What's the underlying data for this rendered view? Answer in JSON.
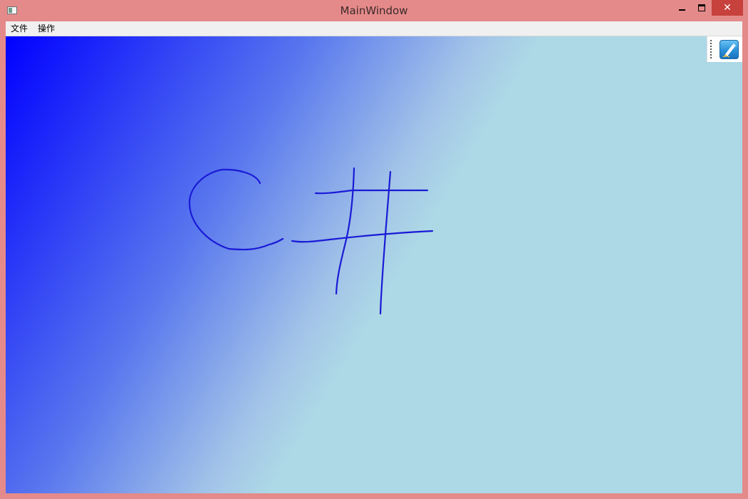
{
  "window": {
    "title": "MainWindow",
    "close_glyph": "✕"
  },
  "menu": {
    "items": [
      {
        "label": "文件"
      },
      {
        "label": "操作"
      }
    ]
  },
  "toolbox": {
    "pen_icon": "pen-icon"
  },
  "canvas": {
    "ink_color": "#1a1ad6",
    "background_gradient": [
      "#0000ff",
      "#add8e6"
    ]
  }
}
